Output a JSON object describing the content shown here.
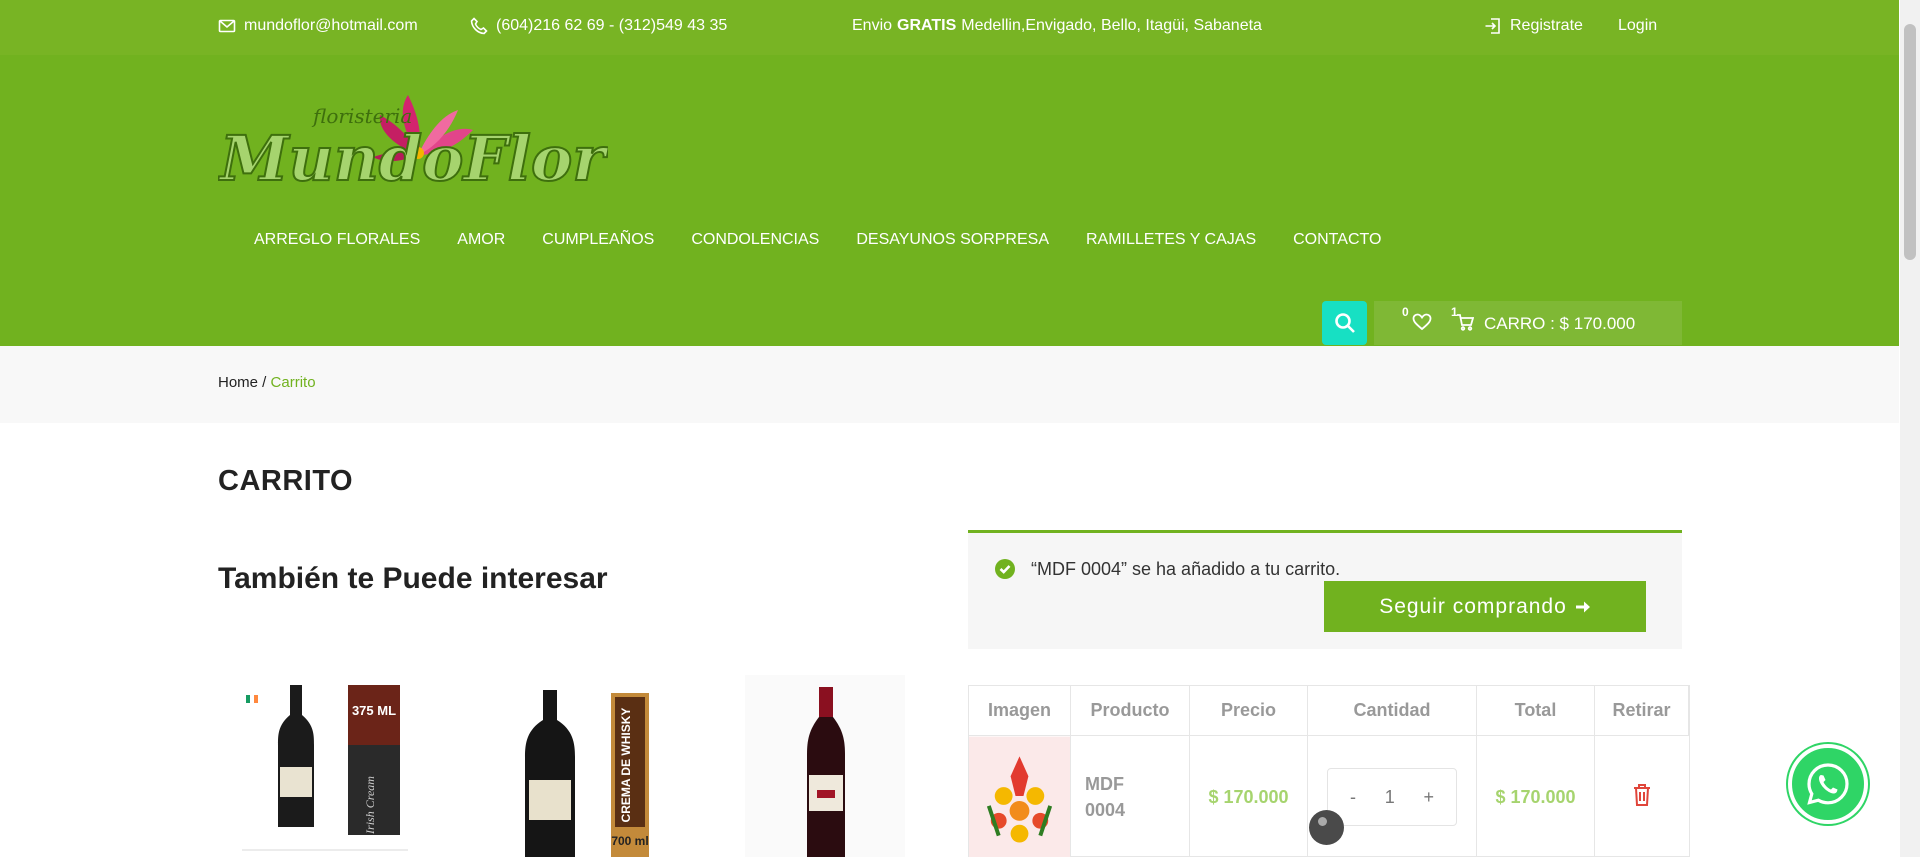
{
  "topbar": {
    "email": "mundoflor@hotmail.com",
    "phone": "(604)216 62 69 - (312)549 43 35",
    "shipping_prefix": "Envio",
    "shipping_bold": "GRATIS",
    "shipping_cities": "Medellin,Envigado, Bello, Itagüi, Sabaneta",
    "register": "Registrate",
    "login": "Login"
  },
  "logo": {
    "small": "floristeria",
    "main": "MundoFlor"
  },
  "nav": [
    "ARREGLO FLORALES",
    "AMOR",
    "CUMPLEAÑOS",
    "CONDOLENCIAS",
    "DESAYUNOS SORPRESA",
    "RAMILLETES Y CAJAS",
    "CONTACTO"
  ],
  "cart_widget": {
    "wishlist_count": "0",
    "cart_count": "1",
    "label": "CARRO : $ 170.000"
  },
  "breadcrumb": {
    "home": "Home",
    "sep": " / ",
    "current": "Carrito"
  },
  "page_title": "CARRITO",
  "related_title": "También te Puede interesar",
  "related_products": [
    {
      "badge_size": "375 ML",
      "label": "Irish Cream"
    },
    {
      "label": "CREMA DE WHISKY",
      "size": "700 ml"
    },
    {
      "label": "wine"
    }
  ],
  "notice": {
    "message": "“MDF 0004” se ha añadido a tu carrito.",
    "button": "Seguir comprando"
  },
  "cart_table": {
    "headers": [
      "Imagen",
      "Producto",
      "Precio",
      "Cantidad",
      "Total",
      "Retirar"
    ],
    "rows": [
      {
        "product": "MDF 0004",
        "price": "$ 170.000",
        "qty_minus": "-",
        "qty": "1",
        "qty_plus": "+",
        "total": "$ 170.000"
      }
    ]
  },
  "colors": {
    "brand_green": "#71b21f",
    "top_green": "#78b424",
    "accent_teal": "#17e0c3",
    "delete_red": "#e0453a"
  },
  "icons": [
    "mail-icon",
    "phone-icon",
    "login-icon",
    "search-icon",
    "heart-icon",
    "cart-icon",
    "check-icon",
    "arrow-right-icon",
    "trash-icon",
    "whatsapp-icon"
  ]
}
